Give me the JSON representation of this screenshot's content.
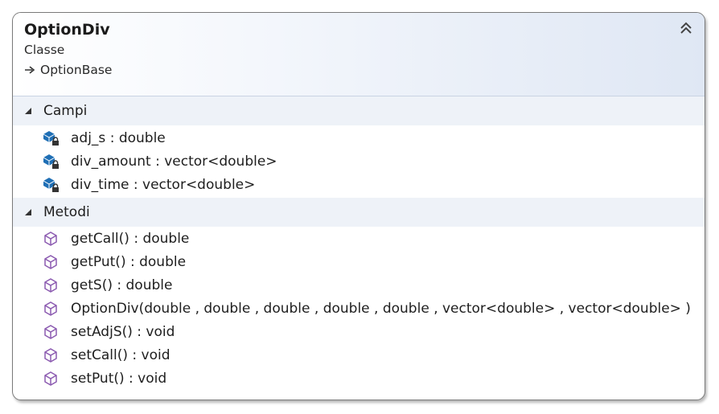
{
  "class": {
    "name": "OptionDiv",
    "kind": "Classe",
    "base": "OptionBase"
  },
  "icons": {
    "collapse": "double-chevron-up-icon",
    "inherit": "inheritance-arrow-icon",
    "field": "private-field-icon",
    "method": "method-cube-icon",
    "section_toggle": "triangle-expanded-icon"
  },
  "colors": {
    "header_gradient_end": "#dfe7f4",
    "section_band": "#eef2f8",
    "field_icon": "#1f6fb5",
    "method_icon": "#8b5ab0",
    "border": "#7a7a7a"
  },
  "sections": {
    "fields": {
      "label": "Campi",
      "items": [
        "adj_s : double",
        "div_amount : vector<double>",
        "div_time : vector<double>"
      ]
    },
    "methods": {
      "label": "Metodi",
      "items": [
        "getCall() : double",
        "getPut() : double",
        "getS() : double",
        "OptionDiv(double , double , double , double , double , vector<double> , vector<double> )",
        "setAdjS() : void",
        "setCall() : void",
        "setPut() : void"
      ]
    }
  }
}
